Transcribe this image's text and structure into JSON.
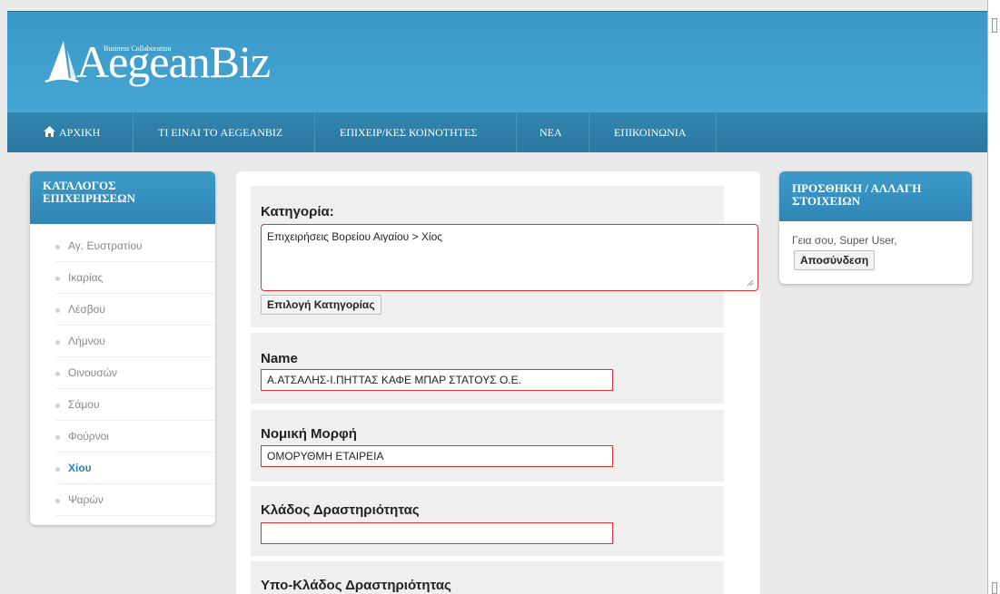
{
  "brand": {
    "name": "AegeanBiz",
    "tagline": "Business Collaboration"
  },
  "nav": [
    {
      "label": "ΑΡΧΙΚΗ",
      "icon": "home-icon"
    },
    {
      "label": "ΤΙ ΕΙΝΑΙ ΤΟ AEGEANBIZ"
    },
    {
      "label": "ΕΠΙΧΕΙΡ/ΚΕΣ ΚΟΙΝΟΤΗΤΕΣ"
    },
    {
      "label": "ΝΕΑ"
    },
    {
      "label": "ΕΠΙΚΟΙΝΩΝΙΑ"
    }
  ],
  "catalog": {
    "title_line1": "ΚΑΤΑΛΟΓΟΣ",
    "title_line2": "ΕΠΙΧΕΙΡΗΣΕΩΝ",
    "items": [
      "Αγ. Ευστρατίου",
      "Ικαρίας",
      "Λέσβου",
      "Λήμνου",
      "Οινουσών",
      "Σάμου",
      "Φούρνοι",
      "Χίου",
      "Ψαρών"
    ],
    "active_item": "Χίου"
  },
  "account": {
    "title_line1": "ΠΡΟΣΘΗΚΗ / ΑΛΛΑΓΗ",
    "title_line2": "ΣΤΟΙΧΕΙΩΝ",
    "greeting": "Γεια σου, Super User,",
    "logout_label": "Αποσύνδεση"
  },
  "form": {
    "category": {
      "label": "Κατηγορία:",
      "value": "Επιχειρήσεις Βορείου Αιγαίου > Χίος",
      "select_button": "Επιλογή Κατηγορίας"
    },
    "name": {
      "label": "Name",
      "value": "Α.ΑΤΣΑΛΗΣ-Ι.ΠΗΤΤΑΣ ΚΑΦΕ ΜΠΑΡ ΣΤΑΤΟΥΣ Ο.Ε."
    },
    "legal_form": {
      "label": "Νομική Μορφή",
      "value": "ΟΜΟΡΥΘΜΗ ΕΤΑΙΡΕΙΑ"
    },
    "activity_sector": {
      "label": "Κλάδος Δραστηριότητας",
      "value": ""
    },
    "activity_subsector": {
      "label": "Υπο-Κλάδος Δραστηριότητας"
    }
  },
  "colors": {
    "header": "#3d9cc9",
    "nav": "#2e7ea7",
    "accent_blue": "#2c7fb1",
    "error_border": "#dd3333"
  }
}
